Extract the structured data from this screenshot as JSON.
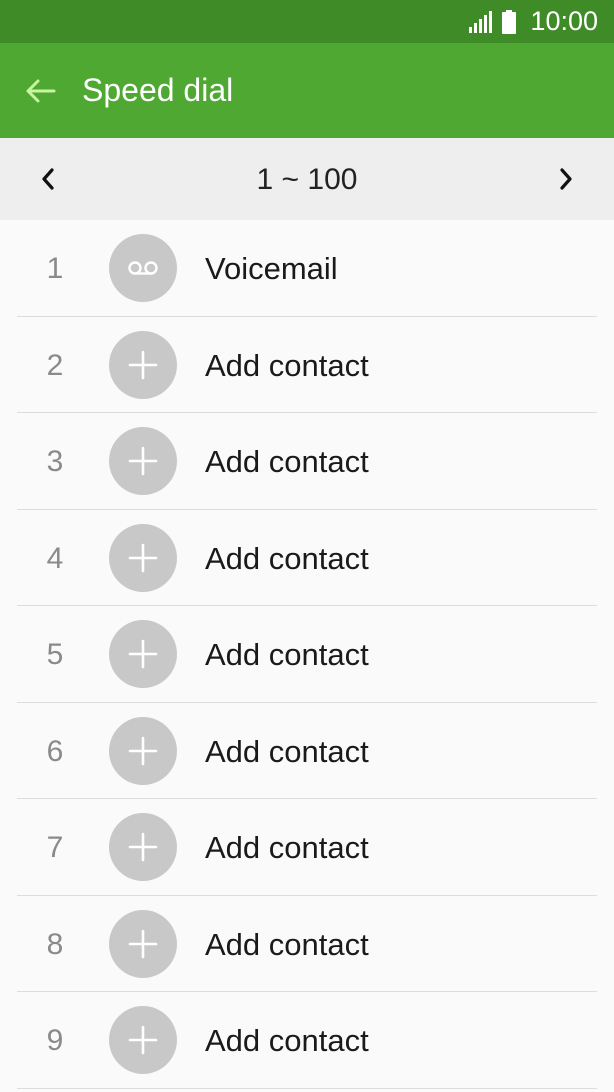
{
  "status_bar": {
    "time": "10:00",
    "signal_icon": "signal-icon",
    "battery_icon": "battery-icon"
  },
  "app_bar": {
    "title": "Speed dial",
    "back_icon": "back-arrow-icon"
  },
  "range": {
    "label": "1 ~ 100",
    "prev_icon": "chevron-left-icon",
    "next_icon": "chevron-right-icon"
  },
  "entries": [
    {
      "number": "1",
      "label": "Voicemail",
      "icon": "voicemail-icon"
    },
    {
      "number": "2",
      "label": "Add contact",
      "icon": "plus-icon"
    },
    {
      "number": "3",
      "label": "Add contact",
      "icon": "plus-icon"
    },
    {
      "number": "4",
      "label": "Add contact",
      "icon": "plus-icon"
    },
    {
      "number": "5",
      "label": "Add contact",
      "icon": "plus-icon"
    },
    {
      "number": "6",
      "label": "Add contact",
      "icon": "plus-icon"
    },
    {
      "number": "7",
      "label": "Add contact",
      "icon": "plus-icon"
    },
    {
      "number": "8",
      "label": "Add contact",
      "icon": "plus-icon"
    },
    {
      "number": "9",
      "label": "Add contact",
      "icon": "plus-icon"
    }
  ],
  "colors": {
    "status_bar": "#3f8b28",
    "app_bar": "#4ea832",
    "back_arrow": "#c8f5a0",
    "avatar": "#c8c8c8",
    "range_bar": "#eeeeee"
  }
}
